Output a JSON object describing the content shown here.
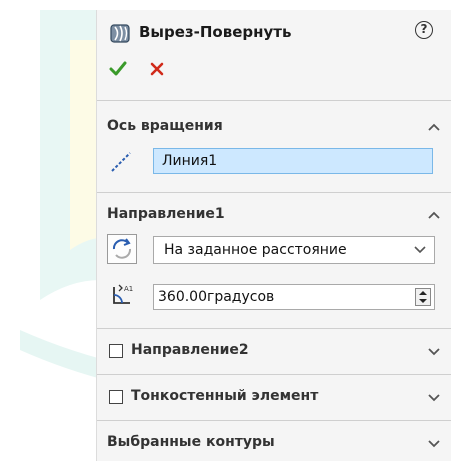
{
  "panel": {
    "title": "Вырез-Повернуть",
    "help_glyph": "?"
  },
  "sections": {
    "axis": {
      "title": "Ось вращения",
      "value": "Линия1"
    },
    "direction1": {
      "title": "Направление1",
      "end_condition": "На заданное расстояние",
      "angle": "360.00градусов"
    },
    "direction2": {
      "label": "Направление2",
      "checked": false
    },
    "thin_feature": {
      "label": "Тонкостенный элемент",
      "checked": false
    },
    "selected_contours": {
      "title": "Выбранные контуры"
    }
  },
  "icons": {
    "feature": "revolve-cut-icon",
    "ok": "check-icon",
    "cancel": "close-icon",
    "axis": "axis-line-icon",
    "reverse": "reverse-direction-icon",
    "angle": "angle-icon",
    "collapse": "chevron-up-icon",
    "expand": "chevron-down-icon"
  },
  "colors": {
    "ok_green": "#3a9a2a",
    "cancel_red": "#d02a1a",
    "field_highlight": "#cde8ff",
    "watermark": "#e8f7f4"
  }
}
